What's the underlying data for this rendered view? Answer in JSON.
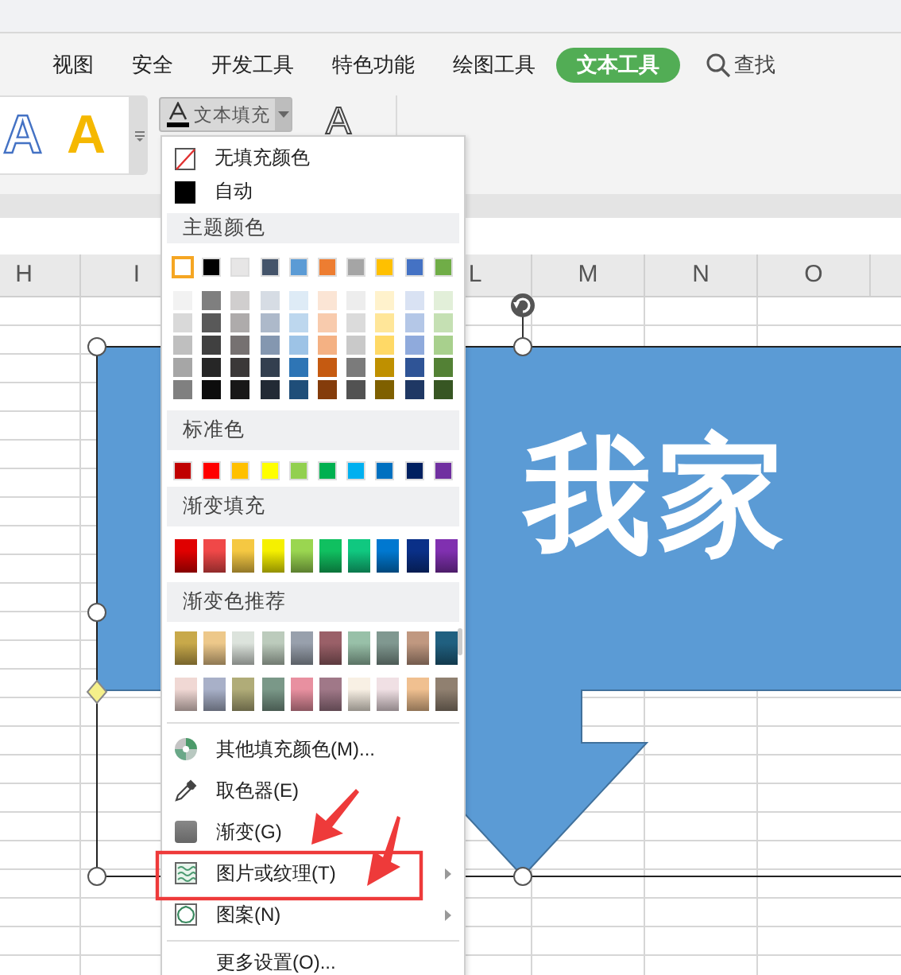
{
  "ribbon_tabs": [
    {
      "label": "视图",
      "selected": false
    },
    {
      "label": "安全",
      "selected": false
    },
    {
      "label": "开发工具",
      "selected": false
    },
    {
      "label": "特色功能",
      "selected": false
    },
    {
      "label": "绘图工具",
      "selected": false
    },
    {
      "label": "文本工具",
      "selected": true
    }
  ],
  "search": {
    "label": "查找"
  },
  "style_gallery": [
    {
      "label": "A",
      "kind": "outline"
    },
    {
      "label": "A",
      "kind": "solid"
    }
  ],
  "text_fill_button": {
    "label": "文本填充",
    "expanded": true
  },
  "text_outline_button": {
    "label": "A"
  },
  "column_headers": [
    "H",
    "I",
    "L",
    "M",
    "N",
    "O"
  ],
  "shape": {
    "text": "我家"
  },
  "fill_menu": {
    "top_items": [
      {
        "label": "无填充颜色",
        "kind": "none"
      },
      {
        "label": "自动",
        "kind": "auto"
      }
    ],
    "theme_header": "主题颜色",
    "theme_colors": [
      {
        "color": "#ffffff",
        "selected": true
      },
      {
        "color": "#000000",
        "selected": false
      },
      {
        "color": "#e7e6e6",
        "selected": false
      },
      {
        "color": "#44546a",
        "selected": false
      },
      {
        "color": "#5b9bd5",
        "selected": false
      },
      {
        "color": "#ed7d31",
        "selected": false
      },
      {
        "color": "#a5a5a5",
        "selected": false
      },
      {
        "color": "#ffc000",
        "selected": false
      },
      {
        "color": "#4472c4",
        "selected": false
      },
      {
        "color": "#70ad47",
        "selected": false
      }
    ],
    "theme_shades": [
      {
        "swatches": [
          {
            "color": "#f2f2f2"
          },
          {
            "color": "#7f7f7f"
          },
          {
            "color": "#d0cece"
          },
          {
            "color": "#d6dce4"
          },
          {
            "color": "#deebf6"
          },
          {
            "color": "#fbe5d5"
          },
          {
            "color": "#ededed"
          },
          {
            "color": "#fff2cc"
          },
          {
            "color": "#d9e2f3"
          },
          {
            "color": "#e2efd9"
          }
        ]
      },
      {
        "swatches": [
          {
            "color": "#d9d9d9"
          },
          {
            "color": "#595959"
          },
          {
            "color": "#aeabab"
          },
          {
            "color": "#adb9ca"
          },
          {
            "color": "#bdd7ee"
          },
          {
            "color": "#f8cbad"
          },
          {
            "color": "#dbdbdb"
          },
          {
            "color": "#ffe699"
          },
          {
            "color": "#b4c7e7"
          },
          {
            "color": "#c5e0b3"
          }
        ]
      },
      {
        "swatches": [
          {
            "color": "#bfbfbf"
          },
          {
            "color": "#404040"
          },
          {
            "color": "#767171"
          },
          {
            "color": "#8497b0"
          },
          {
            "color": "#9dc3e6"
          },
          {
            "color": "#f4b183"
          },
          {
            "color": "#c9c9c9"
          },
          {
            "color": "#ffd966"
          },
          {
            "color": "#8faadc"
          },
          {
            "color": "#a8d08d"
          }
        ]
      },
      {
        "swatches": [
          {
            "color": "#a6a6a6"
          },
          {
            "color": "#262626"
          },
          {
            "color": "#3b3838"
          },
          {
            "color": "#333f4f"
          },
          {
            "color": "#2e75b5"
          },
          {
            "color": "#c55a11"
          },
          {
            "color": "#7b7b7b"
          },
          {
            "color": "#bf9000"
          },
          {
            "color": "#2f5496"
          },
          {
            "color": "#538135"
          }
        ]
      },
      {
        "swatches": [
          {
            "color": "#808080"
          },
          {
            "color": "#0d0d0d"
          },
          {
            "color": "#181717"
          },
          {
            "color": "#222a35"
          },
          {
            "color": "#1f4e79"
          },
          {
            "color": "#843c0b"
          },
          {
            "color": "#525252"
          },
          {
            "color": "#7f6000"
          },
          {
            "color": "#1f3864"
          },
          {
            "color": "#375623"
          }
        ]
      }
    ],
    "standard_header": "标准色",
    "standard_colors": [
      {
        "color": "#c00000"
      },
      {
        "color": "#ff0000"
      },
      {
        "color": "#ffc000"
      },
      {
        "color": "#ffff00"
      },
      {
        "color": "#92d050"
      },
      {
        "color": "#00b050"
      },
      {
        "color": "#00b0f0"
      },
      {
        "color": "#0070c0"
      },
      {
        "color": "#002060"
      },
      {
        "color": "#7030a0"
      }
    ],
    "gradient_header": "渐变填充",
    "gradient_colors": [
      {
        "color": "#e00000"
      },
      {
        "color": "#f04848"
      },
      {
        "color": "#f5c842"
      },
      {
        "color": "#f5f000"
      },
      {
        "color": "#9ad650"
      },
      {
        "color": "#10c060"
      },
      {
        "color": "#10c880"
      },
      {
        "color": "#0078d0"
      },
      {
        "color": "#0a3088"
      },
      {
        "color": "#8030b0"
      }
    ],
    "recommended_header": "渐变色推荐",
    "recommended_rows": [
      {
        "swatches": [
          {
            "color": "#c8a94a"
          },
          {
            "color": "#edc88a"
          },
          {
            "color": "#dce3dc"
          },
          {
            "color": "#bccbbc"
          },
          {
            "color": "#98a0ac"
          },
          {
            "color": "#9a6068"
          },
          {
            "color": "#98c0a8"
          },
          {
            "color": "#809890"
          },
          {
            "color": "#c09880"
          },
          {
            "color": "#206080"
          }
        ]
      },
      {
        "swatches": [
          {
            "color": "#f0d8d4"
          },
          {
            "color": "#a8b0c8"
          },
          {
            "color": "#b0ac78"
          },
          {
            "color": "#7a9888"
          },
          {
            "color": "#e890a0"
          },
          {
            "color": "#a07888"
          },
          {
            "color": "#f8f0e4"
          },
          {
            "color": "#f0e0e4"
          },
          {
            "color": "#f0c090"
          },
          {
            "color": "#908070"
          }
        ]
      }
    ],
    "actions": [
      {
        "label": "其他填充颜色(M)...",
        "kind": "wheel",
        "submenu": false
      },
      {
        "label": "取色器(E)",
        "kind": "picker",
        "submenu": false
      },
      {
        "label": "渐变(G)",
        "kind": "gradient",
        "submenu": false
      },
      {
        "label": "图片或纹理(T)",
        "kind": "texture",
        "submenu": true
      },
      {
        "label": "图案(N)",
        "kind": "pattern",
        "submenu": true
      }
    ],
    "more_actions": [
      {
        "label": "更多设置(O)..."
      }
    ]
  }
}
